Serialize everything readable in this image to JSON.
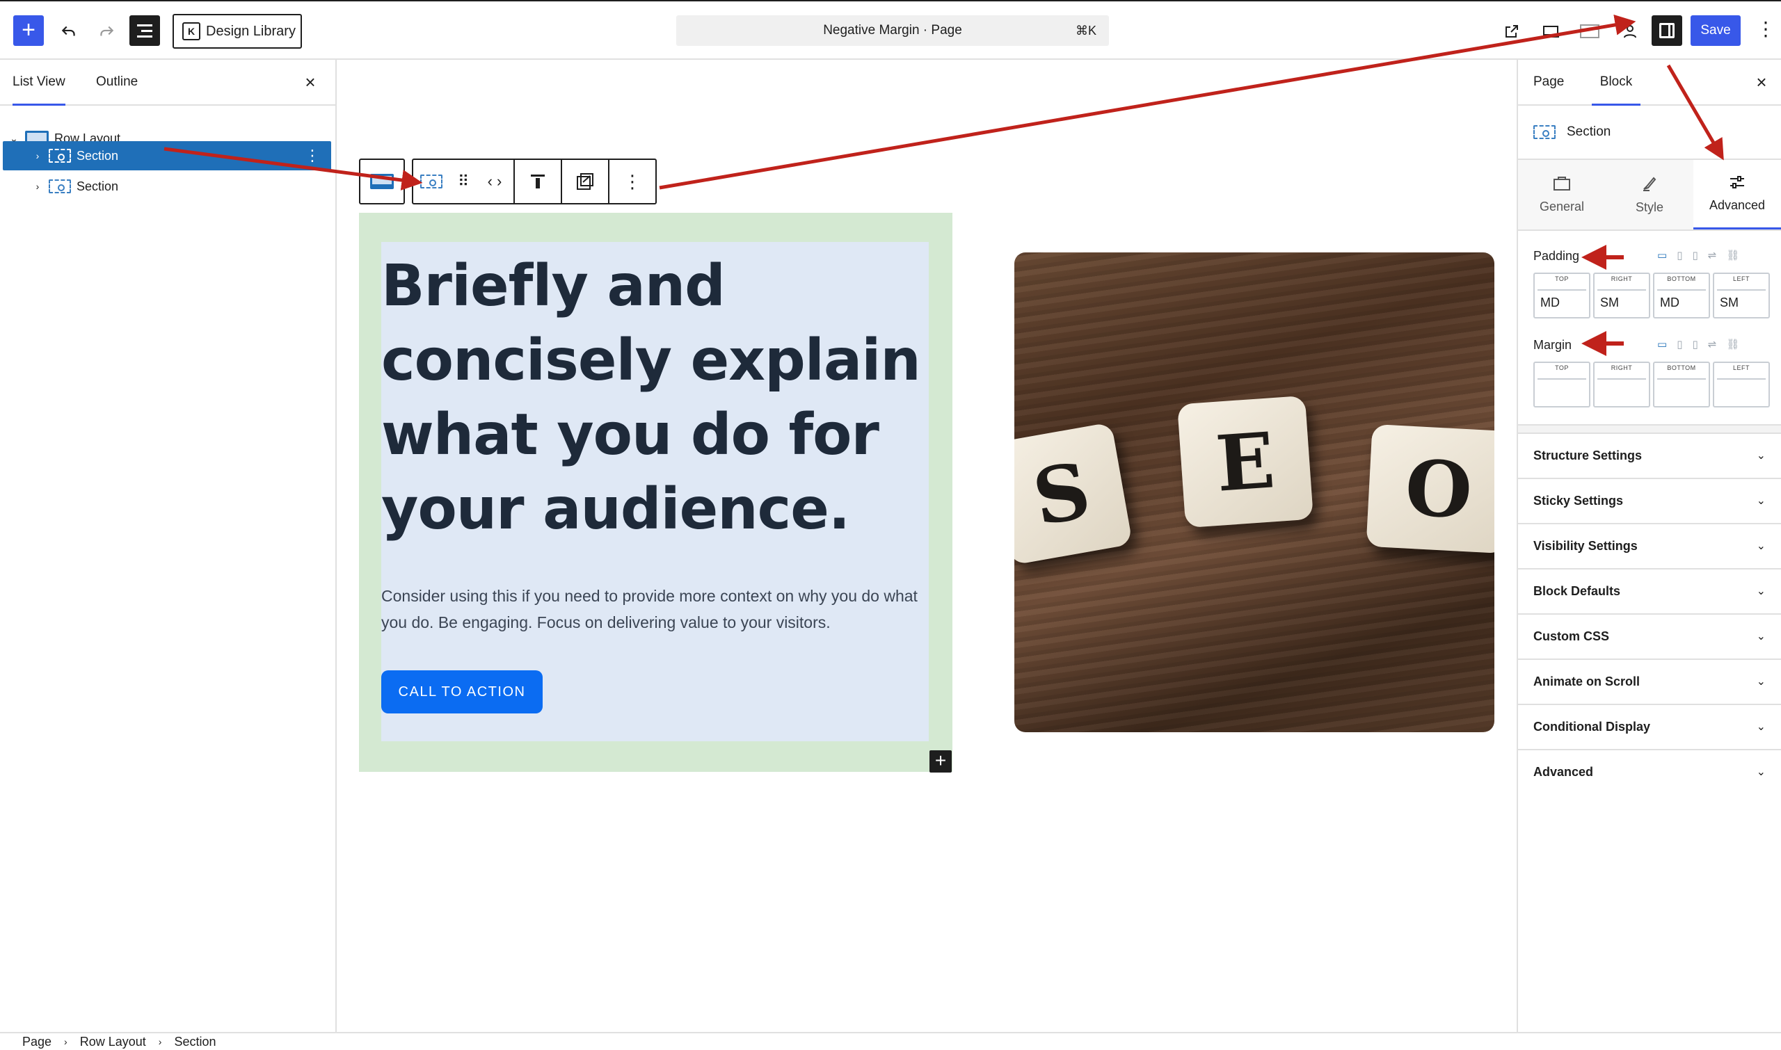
{
  "topbar": {
    "add_label": "+",
    "undo_icon": "undo-icon",
    "redo_icon": "redo-icon",
    "design_library_label": "Design Library",
    "design_library_logo": "K",
    "document_title": "Negative Margin · Page",
    "shortcut": "⌘K",
    "save_label": "Save",
    "more_label": "⋮"
  },
  "left_panel": {
    "tabs": [
      {
        "label": "List View"
      },
      {
        "label": "Outline"
      }
    ],
    "close_label": "×",
    "tree": [
      {
        "label": "Row Layout",
        "chevron": "⌄"
      },
      {
        "label": "Section",
        "chevron": "›"
      },
      {
        "label": "Section",
        "chevron": "›"
      }
    ]
  },
  "canvas": {
    "headline": "Briefly and concisely explain what you do for your audience.",
    "paragraph": "Consider using this if you need to provide more context on why you do what you do. Be engaging. Focus on delivering value to your visitors.",
    "cta_label": "CALL TO ACTION",
    "tiles": [
      "S",
      "E",
      "O"
    ],
    "inserter_label": "+"
  },
  "right_panel": {
    "tabs": [
      {
        "label": "Page"
      },
      {
        "label": "Block"
      }
    ],
    "close_label": "×",
    "block_name": "Section",
    "subtabs": [
      {
        "label": "General",
        "icon": "general-icon"
      },
      {
        "label": "Style",
        "icon": "style-icon"
      },
      {
        "label": "Advanced",
        "icon": "advanced-icon"
      }
    ],
    "padding": {
      "label": "Padding",
      "cells": [
        {
          "label": "TOP",
          "value": "MD"
        },
        {
          "label": "RIGHT",
          "value": "SM"
        },
        {
          "label": "BOTTOM",
          "value": "MD"
        },
        {
          "label": "LEFT",
          "value": "SM"
        }
      ]
    },
    "margin": {
      "label": "Margin",
      "cells": [
        {
          "label": "TOP",
          "value": ""
        },
        {
          "label": "RIGHT",
          "value": ""
        },
        {
          "label": "BOTTOM",
          "value": ""
        },
        {
          "label": "LEFT",
          "value": ""
        }
      ]
    },
    "accordions": [
      {
        "label": "Structure Settings"
      },
      {
        "label": "Sticky Settings"
      },
      {
        "label": "Visibility Settings"
      },
      {
        "label": "Block Defaults"
      },
      {
        "label": "Custom CSS"
      },
      {
        "label": "Animate on Scroll"
      },
      {
        "label": "Conditional Display"
      },
      {
        "label": "Advanced"
      }
    ]
  },
  "breadcrumb": [
    "Page",
    "Row Layout",
    "Section"
  ],
  "colors": {
    "accent": "#3858e9",
    "selected_row": "#1f6fb8",
    "cta": "#0b6cf2",
    "section_bg": "#d4e9d2",
    "inner_bg": "#dfe8f5",
    "annotation_arrow": "#c0221b"
  }
}
